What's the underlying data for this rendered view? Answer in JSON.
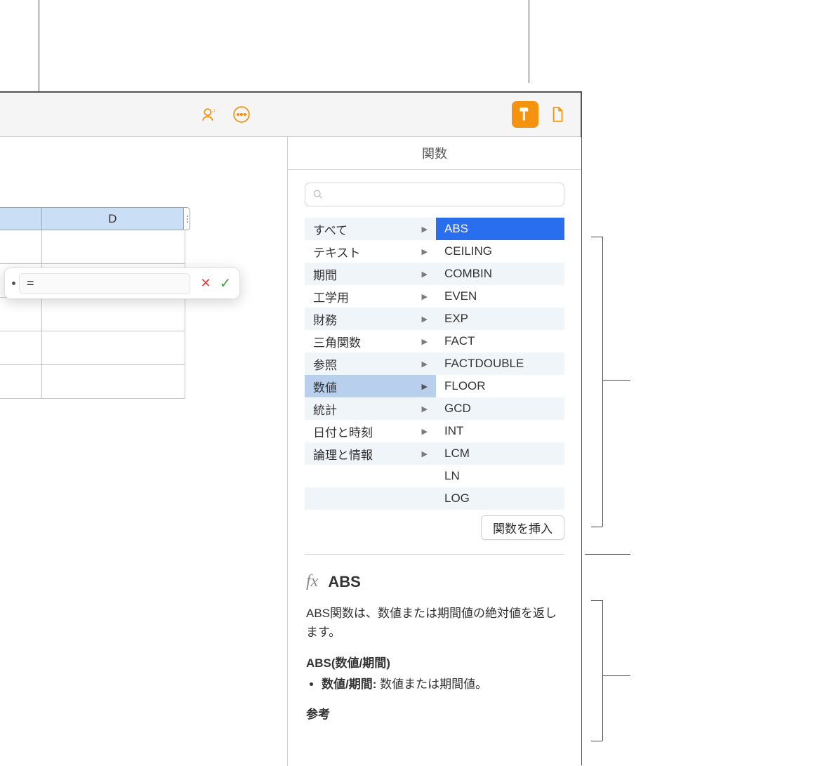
{
  "sidebar": {
    "title": "関数",
    "search_placeholder": ""
  },
  "column": {
    "d_label": "D"
  },
  "formula": {
    "value": "="
  },
  "categories": [
    {
      "label": "すべて",
      "selected": false
    },
    {
      "label": "テキスト",
      "selected": false
    },
    {
      "label": "期間",
      "selected": false
    },
    {
      "label": "工学用",
      "selected": false
    },
    {
      "label": "財務",
      "selected": false
    },
    {
      "label": "三角関数",
      "selected": false
    },
    {
      "label": "参照",
      "selected": false
    },
    {
      "label": "数値",
      "selected": true
    },
    {
      "label": "統計",
      "selected": false
    },
    {
      "label": "日付と時刻",
      "selected": false
    },
    {
      "label": "論理と情報",
      "selected": false
    }
  ],
  "functions": [
    {
      "label": "ABS",
      "selected": true
    },
    {
      "label": "CEILING",
      "selected": false
    },
    {
      "label": "COMBIN",
      "selected": false
    },
    {
      "label": "EVEN",
      "selected": false
    },
    {
      "label": "EXP",
      "selected": false
    },
    {
      "label": "FACT",
      "selected": false
    },
    {
      "label": "FACTDOUBLE",
      "selected": false
    },
    {
      "label": "FLOOR",
      "selected": false
    },
    {
      "label": "GCD",
      "selected": false
    },
    {
      "label": "INT",
      "selected": false
    },
    {
      "label": "LCM",
      "selected": false
    },
    {
      "label": "LN",
      "selected": false
    },
    {
      "label": "LOG",
      "selected": false
    }
  ],
  "insert_label": "関数を挿入",
  "help": {
    "fx_label": "fx",
    "title": "ABS",
    "desc": "ABS関数は、数値または期間値の絶対値を返します。",
    "syntax": "ABS(数値/期間)",
    "arg_name": "数値/期間:",
    "arg_desc": " 数値または期間値。",
    "ref_label": "参考"
  }
}
